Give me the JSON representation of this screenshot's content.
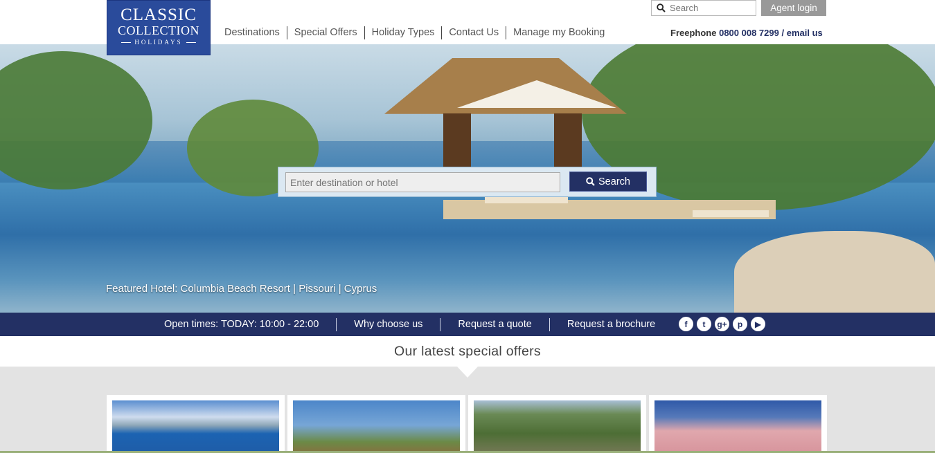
{
  "logo": {
    "line1": "CLASSIC",
    "line2": "COLLECTION",
    "line3": "HOLIDAYS"
  },
  "nav": [
    "Destinations",
    "Special Offers",
    "Holiday Types",
    "Contact Us",
    "Manage my Booking"
  ],
  "top_search": {
    "placeholder": "Search"
  },
  "agent_login": "Agent login",
  "contact": {
    "prefix": "Freephone",
    "number": "0800 008 7299",
    "separator": "/",
    "email": "email us"
  },
  "hero_search": {
    "placeholder": "Enter destination or hotel",
    "button": "Search"
  },
  "featured": "Featured Hotel: Columbia Beach Resort | Pissouri | Cyprus",
  "info_bar": [
    "Open times: TODAY: 10:00 - 22:00",
    "Why choose us",
    "Request a quote",
    "Request a brochure"
  ],
  "social": [
    {
      "name": "facebook-icon",
      "glyph": "f"
    },
    {
      "name": "twitter-icon",
      "glyph": "t"
    },
    {
      "name": "google-plus-icon",
      "glyph": "g+"
    },
    {
      "name": "pinterest-icon",
      "glyph": "p"
    },
    {
      "name": "youtube-icon",
      "glyph": "▶"
    }
  ],
  "offers_title": "Our latest special offers",
  "colors": {
    "brand": "#233064",
    "logo": "#2a4b9b",
    "agent": "#999999"
  }
}
